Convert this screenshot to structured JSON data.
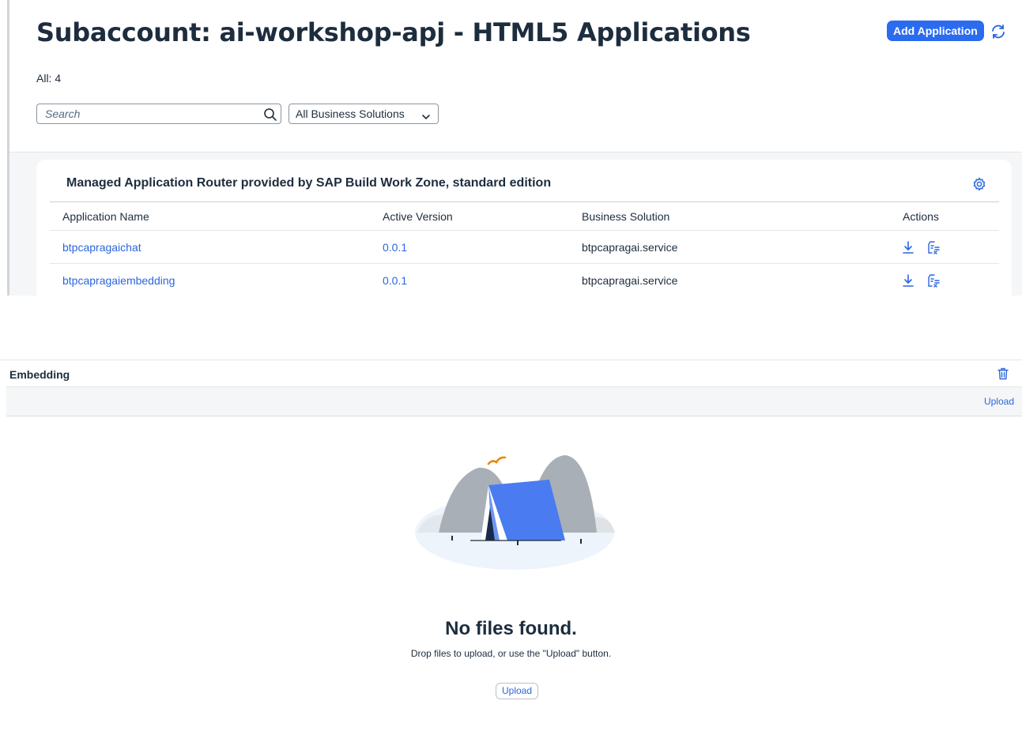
{
  "header": {
    "title": "Subaccount: ai-workshop-apj - HTML5 Applications",
    "add_button": "Add Application",
    "refresh_icon": "refresh-icon",
    "count_label": "All: 4"
  },
  "filters": {
    "search_placeholder": "Search",
    "search_value": "",
    "business_solution_selected": "All Business Solutions"
  },
  "card": {
    "title": "Managed Application Router provided by SAP Build Work Zone, standard edition",
    "settings_icon": "gear-icon",
    "columns": [
      "Application Name",
      "Active Version",
      "Business Solution",
      "Actions"
    ],
    "rows": [
      {
        "name": "btpcapragaichat",
        "version": "0.0.1",
        "solution": "btpcapragai.service"
      },
      {
        "name": "btpcapragaiembedding",
        "version": "0.0.1",
        "solution": "btpcapragai.service"
      }
    ],
    "action_icons": [
      "download-icon",
      "undeploy-icon"
    ]
  },
  "embedding": {
    "title": "Embedding",
    "delete_icon": "trash-icon",
    "toolbar_upload": "Upload",
    "empty_title": "No files found.",
    "empty_subtitle": "Drop files to upload, or use the \"Upload\" button.",
    "upload_button": "Upload"
  },
  "colors": {
    "accent": "#2b6bf0",
    "link": "#2b66dd",
    "text": "#1d2d3e",
    "tent": "#4a7bf0",
    "bird": "#e8850c"
  }
}
